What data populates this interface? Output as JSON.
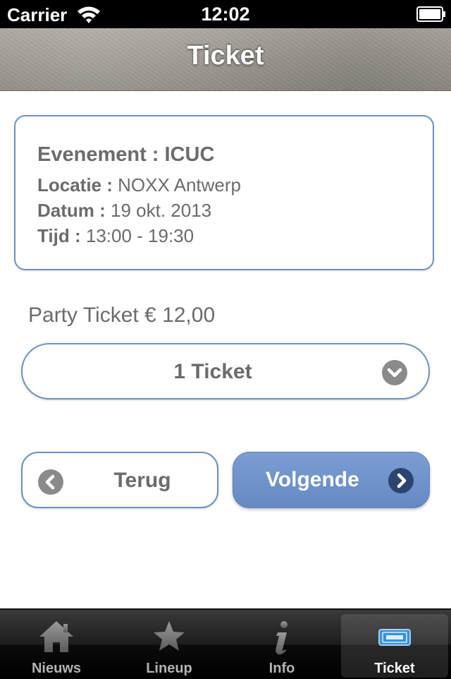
{
  "status_bar": {
    "carrier": "Carrier",
    "time": "12:02"
  },
  "nav": {
    "title": "Ticket"
  },
  "event": {
    "name": "Evenement : ICUC",
    "location_label": "Locatie :",
    "location_value": "NOXX Antwerp",
    "date_label": "Datum :",
    "date_value": "19 okt. 2013",
    "time_label": "Tijd :",
    "time_value": "13:00 - 19:30"
  },
  "ticket": {
    "price_text": "Party Ticket € 12,00",
    "selected_quantity": "1 Ticket"
  },
  "buttons": {
    "back_label": "Terug",
    "next_label": "Volgende"
  },
  "tabs": [
    {
      "label": "Nieuws",
      "icon": "house-icon",
      "active": false
    },
    {
      "label": "Lineup",
      "icon": "star-icon",
      "active": false
    },
    {
      "label": "Info",
      "icon": "info-icon",
      "active": false
    },
    {
      "label": "Ticket",
      "icon": "ticket-icon",
      "active": true
    }
  ],
  "colors": {
    "accent": "#6f90c4",
    "primary_button": "#7093cc",
    "text_gray": "#6b6b6b"
  }
}
